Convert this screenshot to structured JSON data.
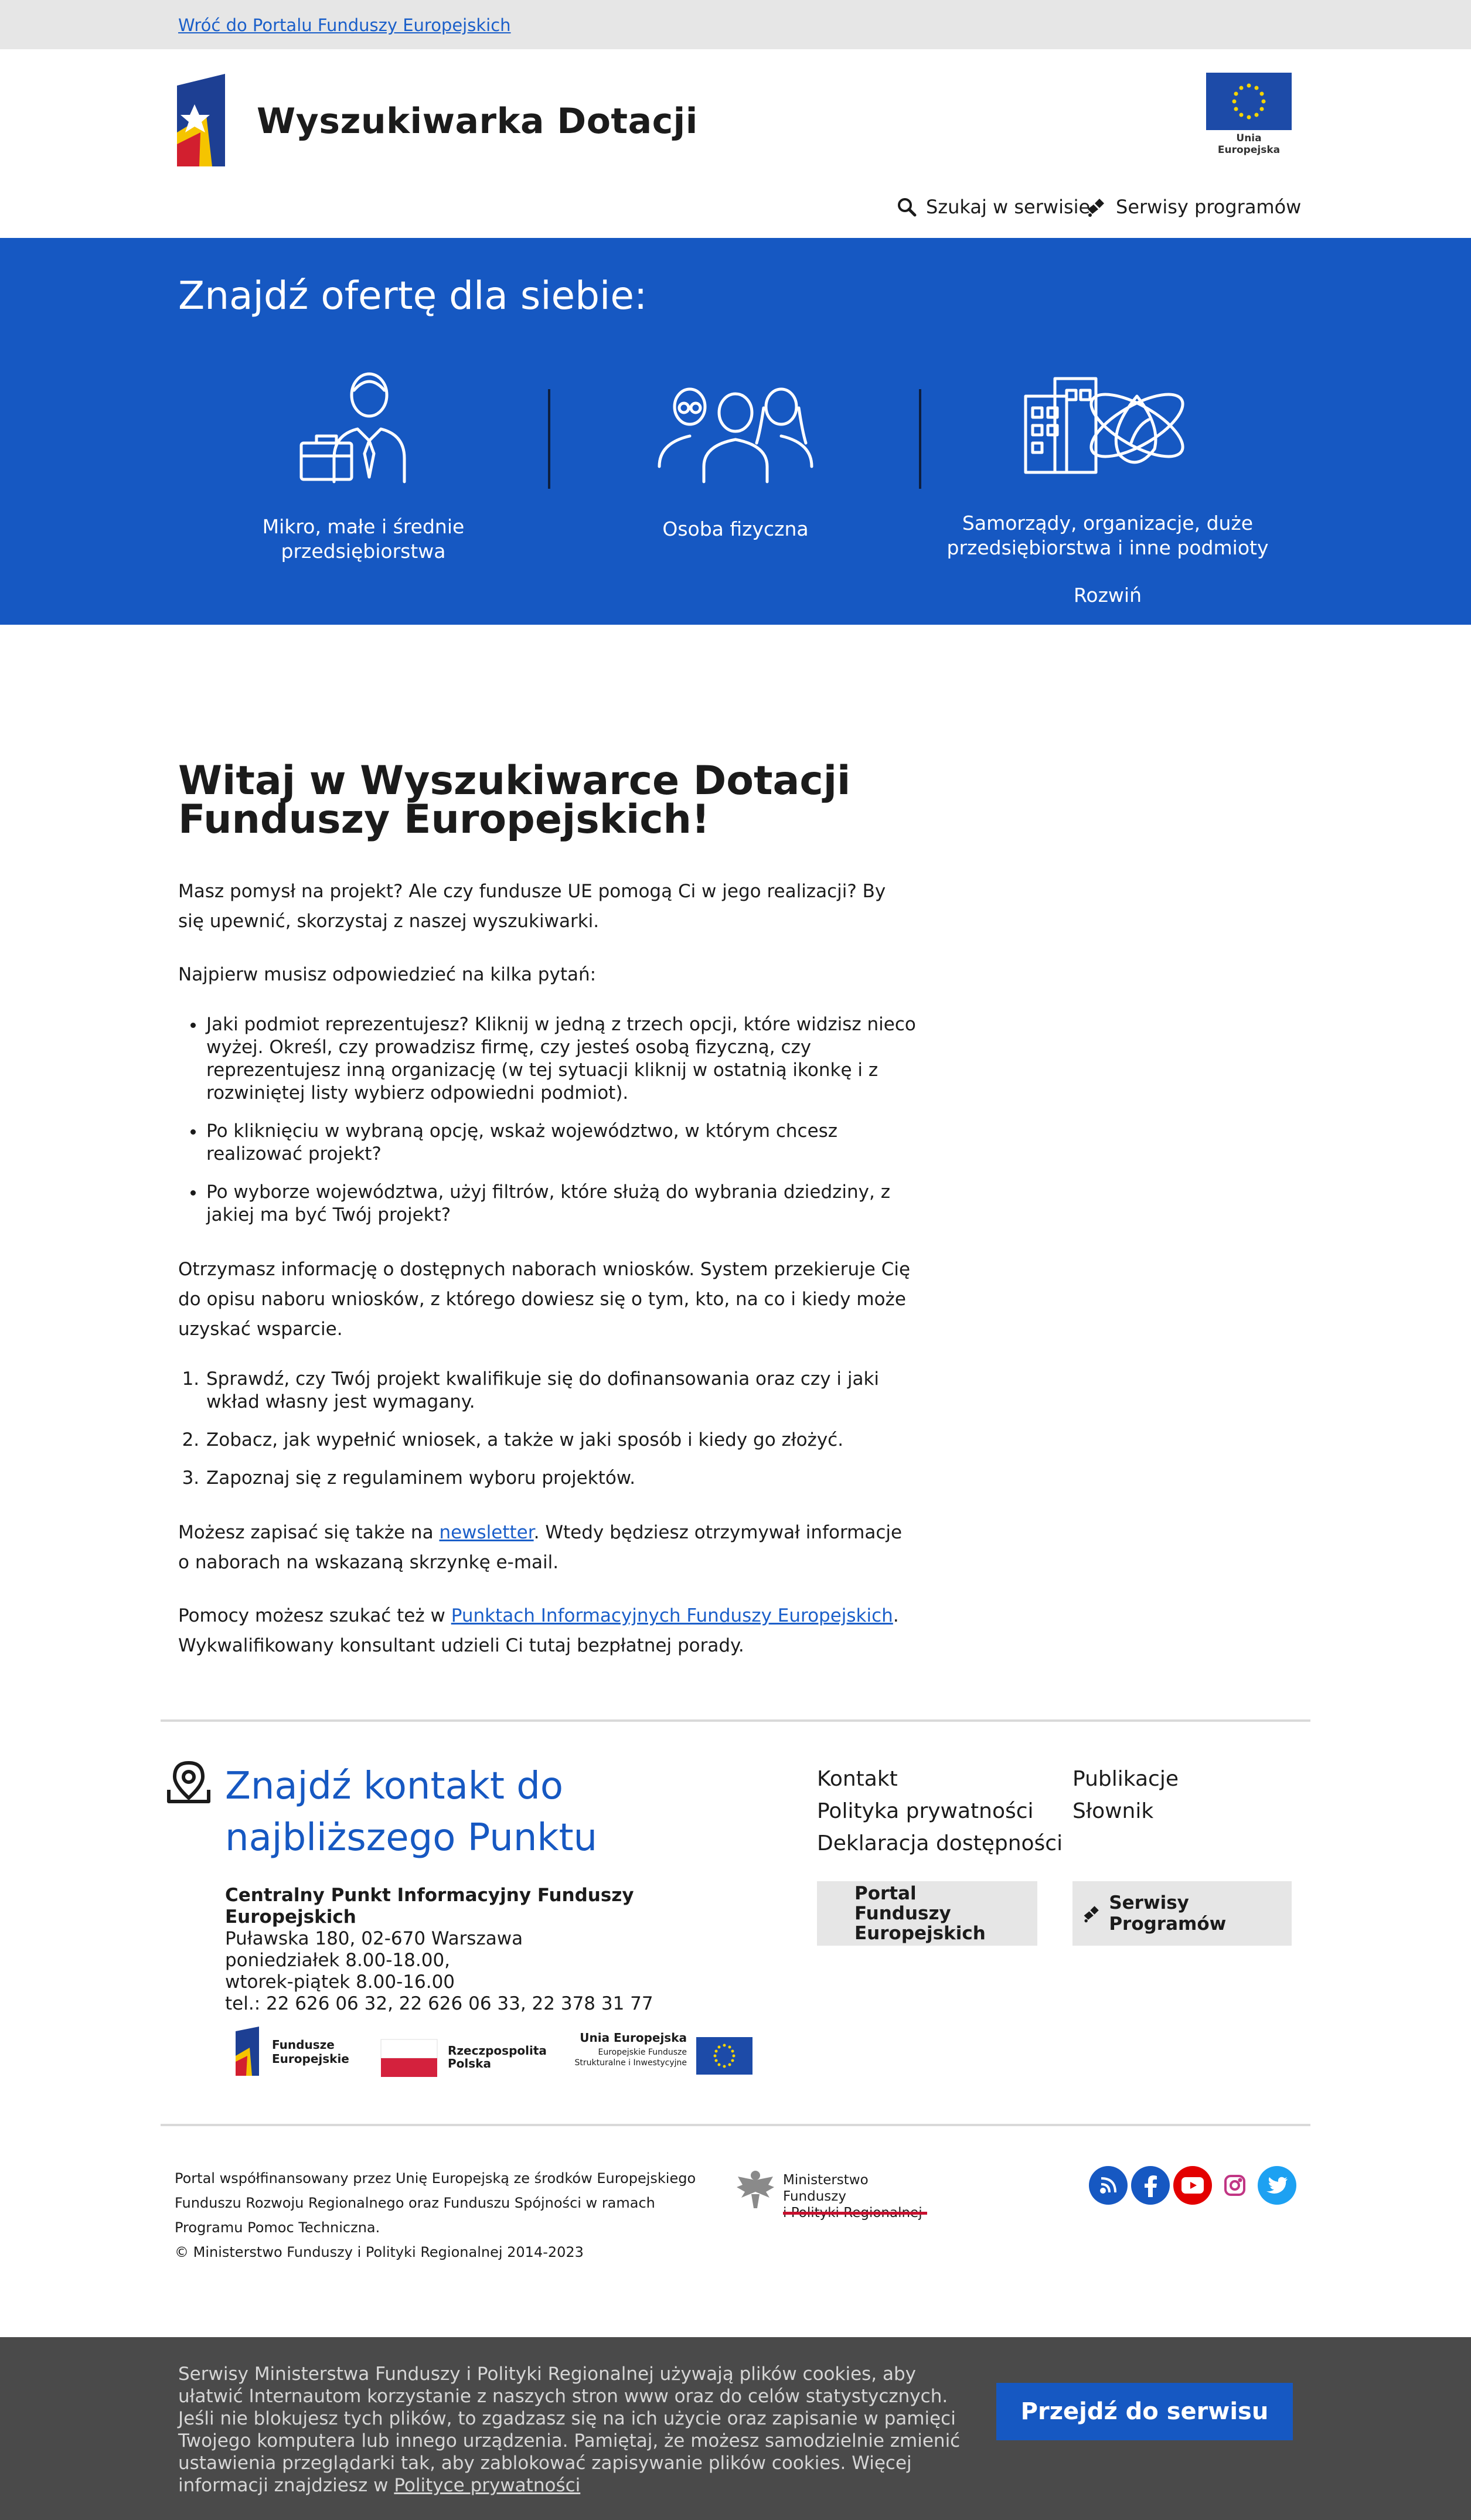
{
  "topbar": {
    "back_link": "Wróć do Portalu Funduszy Europejskich"
  },
  "header": {
    "site_title": "Wyszukiwarka Dotacji",
    "eu_label": "Unia Europejska",
    "search_label": "Szukaj w serwisie",
    "services_label": "Serwisy programów"
  },
  "banner": {
    "heading": "Znajdź ofertę dla siebie:",
    "offers": [
      {
        "label": "Mikro, małe i średnie przedsiębiorstwa",
        "icon": "businessman-briefcase-icon"
      },
      {
        "label": "Osoba fizyczna",
        "icon": "people-group-icon"
      },
      {
        "label": "Samorządy, organizacje, duże przedsiębiorstwa i inne podmioty",
        "icon": "buildings-atom-icon"
      }
    ],
    "expand_label": "Rozwiń"
  },
  "main": {
    "title": "Witaj w Wyszukiwarce Dotacji Funduszy Europejskich!",
    "intro": "Masz pomysł na projekt? Ale czy fundusze UE pomogą Ci w jego realizacji? By się upewnić, skorzystaj z naszej wyszukiwarki.",
    "steps_intro": "Najpierw musisz odpowiedzieć na kilka pytań:",
    "bullets": [
      "Jaki podmiot reprezentujesz? Kliknij w jedną z trzech opcji, które widzisz nieco wyżej. Określ, czy prowadzisz firmę, czy jesteś osobą fizyczną, czy reprezentujesz inną organizację (w tej sytuacji kliknij w ostatnią ikonkę i z rozwiniętej listy wybierz odpowiedni podmiot).",
      "Po kliknięciu w wybraną opcję, wskaż województwo, w którym chcesz realizować projekt?",
      "Po wyborze województwa, użyj filtrów, które służą do wybrania dziedziny, z jakiej ma być Twój projekt?"
    ],
    "info": "Otrzymasz informację o dostępnych naborach wniosków. System przekieruje Cię do opisu naboru wniosków, z którego dowiesz się o tym, kto, na co i kiedy może uzyskać wsparcie.",
    "numbered": [
      "Sprawdź, czy Twój projekt kwalifikuje się do dofinansowania oraz czy i jaki wkład własny jest wymagany.",
      "Zobacz, jak wypełnić wniosek, a także w jaki sposób i kiedy go złożyć.",
      "Zapoznaj się z regulaminem wyboru projektów."
    ],
    "newsletter_before": "Możesz zapisać się także na ",
    "newsletter_link": "newsletter",
    "newsletter_after": ". Wtedy będziesz otrzymywał informacje o naborach na wskazaną skrzynkę e-mail.",
    "help_before": "Pomocy możesz szukać też w ",
    "help_link": "Punktach Informacyjnych Funduszy Europejskich",
    "help_after": ". Wykwalifikowany konsultant udzieli Ci tutaj bezpłatnej porady."
  },
  "footer": {
    "contact_title": "Znajdź kontakt do najbliższego Punktu",
    "contact_name": "Centralny Punkt Informacyjny Funduszy Europejskich",
    "contact_lines": [
      "Puławska 180, 02-670 Warszawa",
      "poniedziałek 8.00-18.00,",
      "wtorek-piątek 8.00-16.00",
      "tel.: 22 626 06 32, 22 626 06 33, 22 378 31 77"
    ],
    "links_col1": [
      "Kontakt",
      "Polityka prywatności",
      "Deklaracja dostępności"
    ],
    "links_col2": [
      "Publikacje",
      "Słownik"
    ],
    "portal_button": "Portal Funduszy Europejskich",
    "programs_button": "Serwisy Programów",
    "partner_fe": [
      "Fundusze",
      "Europejskie"
    ],
    "partner_rp": [
      "Rzeczpospolita",
      "Polska"
    ],
    "partner_ue": [
      "Unia Europejska",
      "Europejskie Fundusze",
      "Strukturalne i Inwestycyjne"
    ],
    "cofinance_text": "Portal współfinansowany przez Unię Europejską ze środków Europejskiego Funduszu Rozwoju Regionalnego oraz Funduszu Spójności w ramach Programu Pomoc Techniczna.",
    "copyright": "© Ministerstwo Funduszy i Polityki Regionalnej 2014-2023",
    "ministry_name": [
      "Ministerstwo Funduszy",
      "i Polityki Regionalnej"
    ],
    "socials": [
      {
        "name": "rss-icon",
        "color": "#1658c2"
      },
      {
        "name": "facebook-icon",
        "color": "#1658c2"
      },
      {
        "name": "youtube-icon",
        "color": "#e30000"
      },
      {
        "name": "instagram-icon",
        "color": "#c13584"
      },
      {
        "name": "twitter-icon",
        "color": "#1da1f2"
      }
    ]
  },
  "cookie": {
    "text_before": "Serwisy Ministerstwa Funduszy i Polityki Regionalnej używają plików cookies, aby ułatwić Internautom korzystanie z naszych stron www oraz do celów statystycznych. Jeśli nie blokujesz tych plików, to zgadzasz się na ich użycie oraz zapisanie w pamięci Twojego komputera lub innego urządzenia. Pamiętaj, że możesz samodzielnie zmienić ustawienia przeglądarki tak, aby zablokować zapisywanie plików cookies. Więcej informacji znajdziesz w ",
    "link": "Polityce prywatności",
    "button": "Przejdź do serwisu"
  },
  "colors": {
    "brand_blue": "#1658c2",
    "topbar_gray": "#e6e6e6",
    "cookie_gray": "#4a4a4a"
  }
}
